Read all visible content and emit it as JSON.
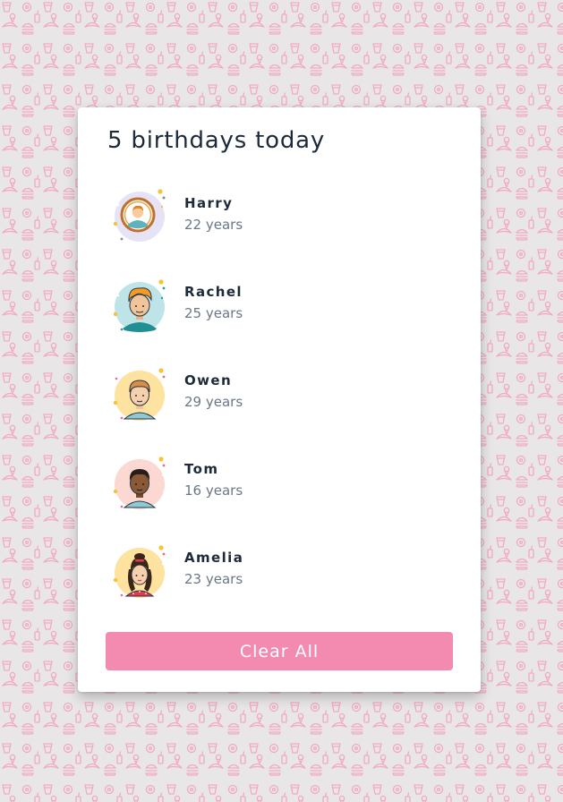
{
  "title": "5 birthdays today",
  "people": [
    {
      "name": "Harry",
      "age": "22 years",
      "avatar_bg": "#e7e3f7",
      "avatar": "harry-avatar-icon"
    },
    {
      "name": "Rachel",
      "age": "25 years",
      "avatar_bg": "#bfe4e8",
      "avatar": "rachel-avatar-icon"
    },
    {
      "name": "Owen",
      "age": "29 years",
      "avatar_bg": "#fde2a0",
      "avatar": "owen-avatar-icon"
    },
    {
      "name": "Tom",
      "age": "16 years",
      "avatar_bg": "#fbd8d2",
      "avatar": "tom-avatar-icon"
    },
    {
      "name": "Amelia",
      "age": "23 years",
      "avatar_bg": "#fde2a0",
      "avatar": "amelia-avatar-icon"
    }
  ],
  "clear_button": "Clear All",
  "colors": {
    "background": "#e8e6e7",
    "pattern": "#f2a9c3",
    "button": "#f38bb1",
    "name_text": "#1d2a3a",
    "age_text": "#6a7886"
  }
}
